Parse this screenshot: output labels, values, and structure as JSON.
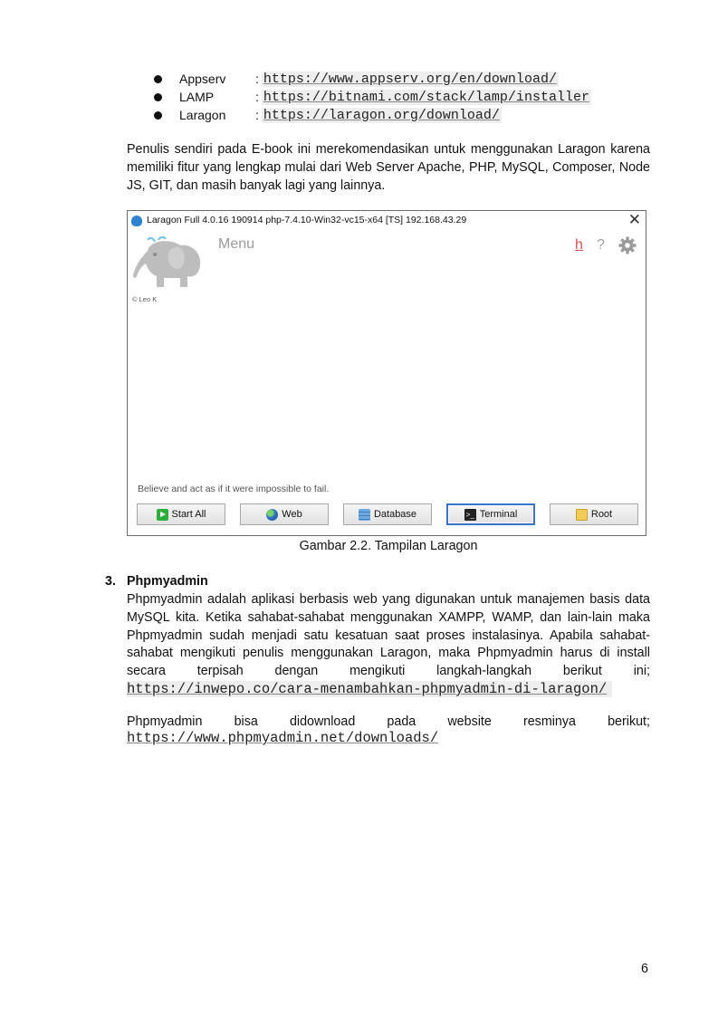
{
  "links": [
    {
      "name": "Appserv",
      "sep": ":",
      "url": "https://www.appserv.org/en/download/"
    },
    {
      "name": "LAMP",
      "sep": ":",
      "url": "https://bitnami.com/stack/lamp/installer"
    },
    {
      "name": "Laragon",
      "sep": ":",
      "url": "https://laragon.org/download/"
    }
  ],
  "para1": "Penulis sendiri pada E-book ini merekomendasikan untuk menggunakan Laragon karena memiliki fitur yang lengkap mulai dari Web Server Apache, PHP, MySQL, Composer, Node JS, GIT, dan masih banyak lagi yang lainnya.",
  "laragon": {
    "title": "Laragon Full 4.0.16 190914 php-7.4.10-Win32-vc15-x64 [TS]  192.168.43.29",
    "close": "✕",
    "credit": "© Leo K",
    "menu": "Menu",
    "help_h": "h",
    "help_q": "?",
    "quote": "Believe and act as if it were impossible to fail.",
    "buttons": {
      "start_all": "Start All",
      "web": "Web",
      "database": "Database",
      "terminal": "Terminal",
      "root": "Root"
    },
    "colors": {
      "accent": "#3a72c9",
      "h_link": "#d9534f",
      "start_green": "#2eac3e"
    }
  },
  "caption": "Gambar 2.2. Tampilan Laragon",
  "section": {
    "number": "3.",
    "title": "Phpmyadmin",
    "para": "Phpmyadmin adalah aplikasi berbasis web yang digunakan untuk manajemen basis data MySQL kita. Ketika sahabat-sahabat menggunakan XAMPP, WAMP, dan lain-lain maka Phpmyadmin sudah menjadi satu kesatuan saat proses instalasinya. Apabila sahabat-sahabat mengikuti penulis menggunakan Laragon, maka Phpmyadmin harus di install secara terpisah dengan mengikuti langkah-langkah berikut ini;",
    "para_url": "https://inwepo.co/cara-menambahkan-phpmyadmin-di-laragon/",
    "para2": "Phpmyadmin bisa didownload pada website resminya berikut;",
    "para2_url": "https://www.phpmyadmin.net/downloads/"
  },
  "page_number": "6"
}
